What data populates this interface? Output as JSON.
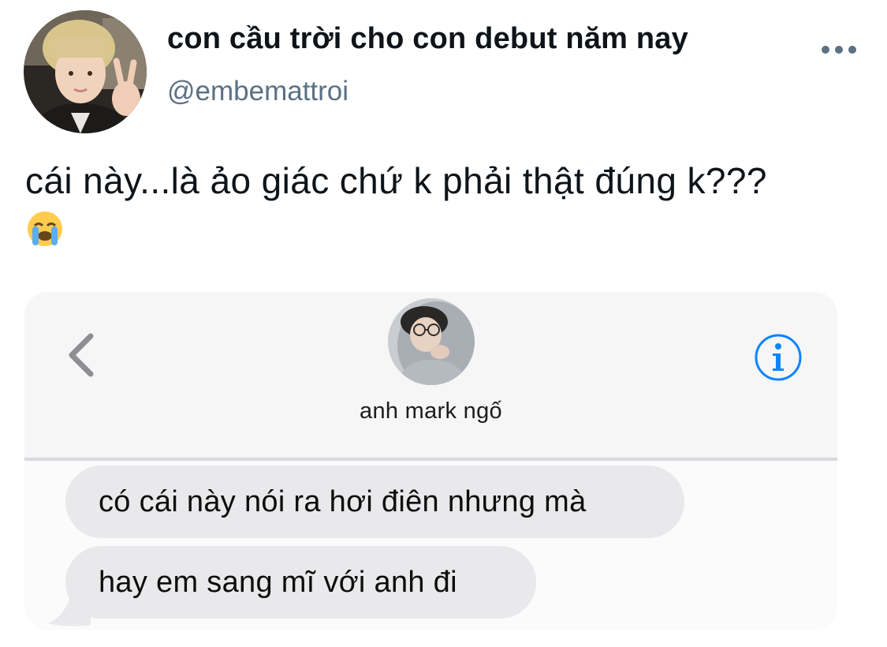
{
  "tweet": {
    "author": {
      "display_name": "con cầu trời cho con debut năm nay",
      "handle": "@embemattroi",
      "avatar_icon": "profile-photo"
    },
    "more_icon": "more-dots-icon",
    "text": "cái này...là ảo giác chứ k phải thật đúng k???",
    "emoji": "loudly-crying-face-emoji"
  },
  "attachment": {
    "type": "messages-screenshot",
    "header": {
      "back_icon": "chevron-left-icon",
      "contact_name": "anh mark ngố",
      "info_icon": "info-icon"
    },
    "messages": [
      {
        "sender": "contact",
        "text": "có cái này nói ra hơi điên nhưng mà"
      },
      {
        "sender": "contact",
        "text": "hay em sang mĩ với anh đi"
      }
    ]
  },
  "colors": {
    "text_primary": "#0f1419",
    "text_secondary": "#5b7083",
    "bubble_gray": "#e9e9eb",
    "ios_blue": "#0a84ff"
  }
}
